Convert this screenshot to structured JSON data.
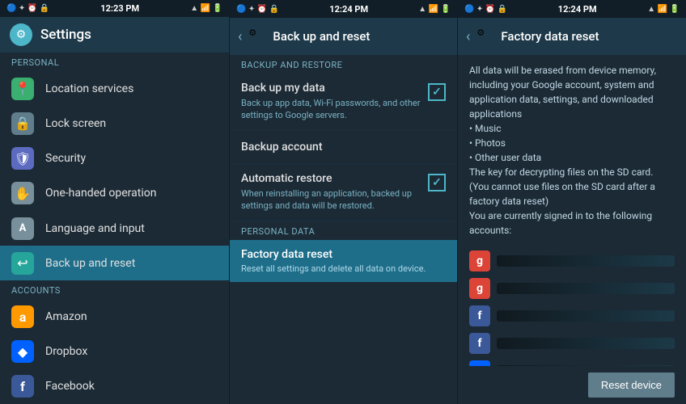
{
  "left_panel": {
    "status_bar": {
      "time": "12:23 PM",
      "icons": "🔵 ✦ ⏰ 🔒 ▲ 📶 🔋"
    },
    "header": {
      "title": "Settings",
      "gear_symbol": "⚙"
    },
    "section_personal": "Personal",
    "menu_items": [
      {
        "id": "location",
        "label": "Location services",
        "icon": "📍",
        "icon_class": "icon-location"
      },
      {
        "id": "lock-screen",
        "label": "Lock screen",
        "icon": "🔒",
        "icon_class": "icon-lock"
      },
      {
        "id": "security",
        "label": "Security",
        "icon": "🛡",
        "icon_class": "icon-security"
      },
      {
        "id": "one-handed",
        "label": "One-handed operation",
        "icon": "✋",
        "icon_class": "icon-onehanded"
      },
      {
        "id": "language",
        "label": "Language and input",
        "icon": "A",
        "icon_class": "icon-language"
      },
      {
        "id": "backup",
        "label": "Back up and reset",
        "icon": "↩",
        "icon_class": "icon-backup",
        "active": true
      }
    ],
    "section_accounts": "Accounts",
    "account_items": [
      {
        "id": "amazon",
        "label": "Amazon",
        "icon": "a",
        "icon_class": "icon-amazon"
      },
      {
        "id": "dropbox",
        "label": "Dropbox",
        "icon": "◆",
        "icon_class": "icon-dropbox"
      },
      {
        "id": "facebook",
        "label": "Facebook",
        "icon": "f",
        "icon_class": "icon-facebook"
      }
    ]
  },
  "middle_panel": {
    "status_bar": {
      "time": "12:24 PM"
    },
    "header": {
      "back_symbol": "‹",
      "title": "Back up and reset",
      "gear_symbol": "⚙"
    },
    "section_backup_restore": "Backup and restore",
    "backup_my_data": {
      "title": "Back up my data",
      "subtitle": "Back up app data, Wi-Fi passwords, and other settings to Google servers.",
      "checked": true
    },
    "backup_account": {
      "title": "Backup account"
    },
    "automatic_restore": {
      "title": "Automatic restore",
      "subtitle": "When reinstalling an application, backed up settings and data will be restored.",
      "checked": true
    },
    "section_personal_data": "Personal data",
    "factory_reset": {
      "title": "Factory data reset",
      "subtitle": "Reset all settings and delete all data on device."
    }
  },
  "right_panel": {
    "status_bar": {
      "time": "12:24 PM"
    },
    "header": {
      "back_symbol": "‹",
      "title": "Factory data reset",
      "gear_symbol": "⚙"
    },
    "description": "All data will be erased from device memory, including your Google account, system and application data, settings, and downloaded applications\n• Music\n• Photos\n• Other user data\nThe key for decrypting files on the SD card. (You cannot use files on the SD card after a factory data reset)\nYou are currently signed in to the following accounts:",
    "accounts": [
      {
        "type": "google",
        "icon": "g",
        "blurred": true
      },
      {
        "type": "google",
        "icon": "g",
        "blurred": true
      },
      {
        "type": "facebook",
        "icon": "f",
        "blurred": true
      },
      {
        "type": "facebook",
        "icon": "f",
        "blurred": true
      },
      {
        "type": "dropbox",
        "icon": "◆",
        "blurred": true
      }
    ],
    "reset_button_label": "Reset device"
  }
}
